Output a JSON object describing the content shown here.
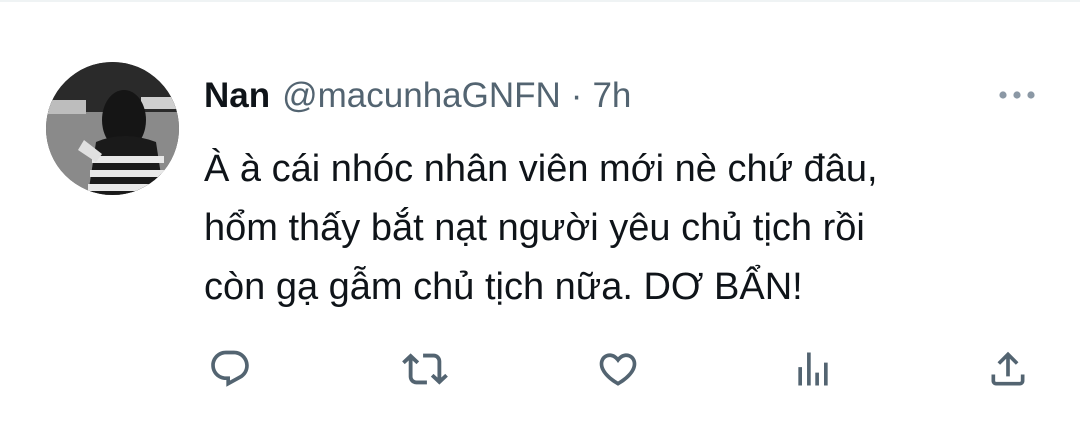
{
  "tweet": {
    "author": {
      "name": "Nan",
      "handle": "@macunhaGNFN"
    },
    "separator": "·",
    "time": "7h",
    "text_lines": [
      "À à cái nhóc nhân viên mới nè chứ đâu,",
      "hổm thấy bắt nạt người yêu chủ tịch rồi",
      "còn gạ gẫm chủ tịch nữa. DƠ BẨN!"
    ]
  },
  "actions": [
    "reply-icon",
    "retweet-icon",
    "like-icon",
    "views-icon",
    "share-icon"
  ],
  "colors": {
    "text_primary": "#0f1419",
    "text_secondary": "#536471",
    "border": "#eff3f4"
  }
}
